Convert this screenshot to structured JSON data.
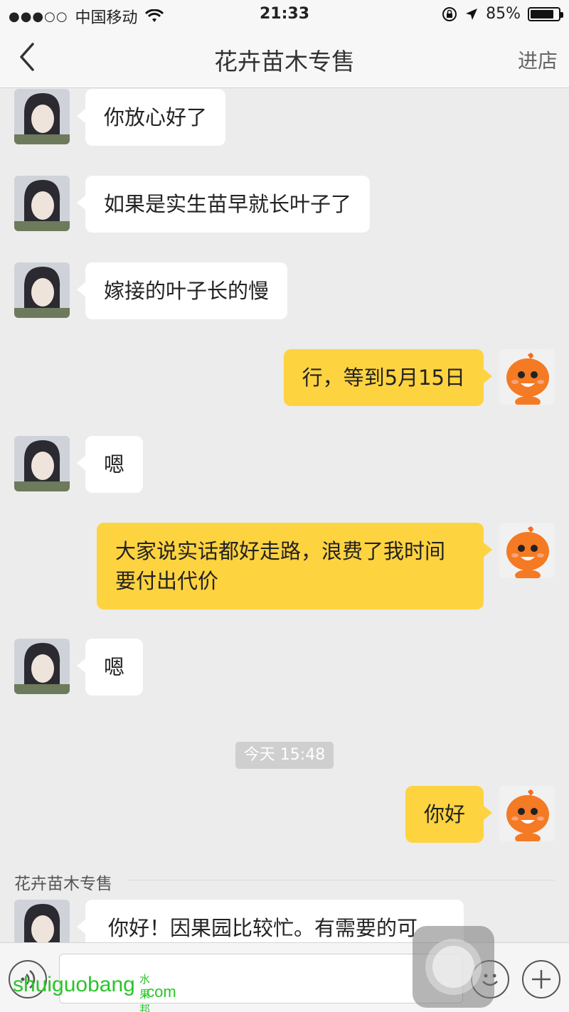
{
  "status_bar": {
    "signal_dots": "●●●○○",
    "carrier": "中国移动",
    "time": "21:33",
    "battery_percent": "85%",
    "battery_level": 0.85
  },
  "nav": {
    "title": "花卉苗木专售",
    "right_action": "进店"
  },
  "messages": [
    {
      "side": "in",
      "text": "你放心好了"
    },
    {
      "side": "in",
      "text": "如果是实生苗早就长叶子了"
    },
    {
      "side": "in",
      "text": "嫁接的叶子长的慢"
    },
    {
      "side": "out",
      "text": "行，等到5月15日"
    },
    {
      "side": "in",
      "text": "嗯"
    },
    {
      "side": "out",
      "text": "大家说实话都好走路，浪费了我时间\n要付出代价"
    },
    {
      "side": "in",
      "text": "嗯"
    },
    {
      "side": "out",
      "text": "你好"
    },
    {
      "side": "in",
      "text": "你好！因果园比较忙。有需要的可"
    }
  ],
  "time_divider": "今天 15:48",
  "sender_name": "花卉苗木专售",
  "watermark": {
    "text": "shuiguobang",
    "cn": "水果邦",
    "suffix": ".com"
  },
  "colors": {
    "outgoing_bubble": "#fed340",
    "incoming_bubble": "#ffffff",
    "background": "#ececec"
  }
}
